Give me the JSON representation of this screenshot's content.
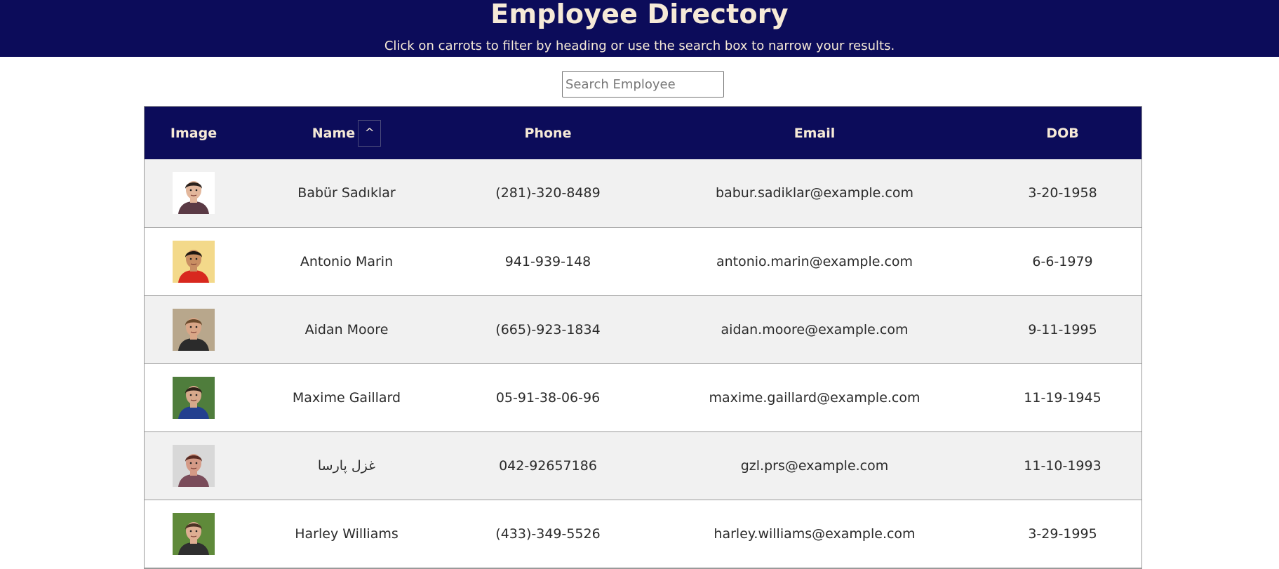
{
  "header": {
    "title": "Employee Directory",
    "subtitle": "Click on carrots to filter by heading or use the search box to narrow your results."
  },
  "search": {
    "placeholder": "Search Employee",
    "value": ""
  },
  "table": {
    "columns": {
      "image": "Image",
      "name": "Name",
      "sort_label": "^",
      "phone": "Phone",
      "email": "Email",
      "dob": "DOB"
    },
    "rows": [
      {
        "name": "Babür Sadıklar",
        "phone": "(281)-320-8489",
        "email": "babur.sadiklar@example.com",
        "dob": "3-20-1958"
      },
      {
        "name": "Antonio Marin",
        "phone": "941-939-148",
        "email": "antonio.marin@example.com",
        "dob": "6-6-1979"
      },
      {
        "name": "Aidan Moore",
        "phone": "(665)-923-1834",
        "email": "aidan.moore@example.com",
        "dob": "9-11-1995"
      },
      {
        "name": "Maxime Gaillard",
        "phone": "05-91-38-06-96",
        "email": "maxime.gaillard@example.com",
        "dob": "11-19-1945"
      },
      {
        "name": "غزل پارسا",
        "phone": "042-92657186",
        "email": "gzl.prs@example.com",
        "dob": "11-10-1993"
      },
      {
        "name": "Harley Williams",
        "phone": "(433)-349-5526",
        "email": "harley.williams@example.com",
        "dob": "3-29-1995"
      }
    ]
  },
  "avatars": [
    {
      "icon": "person-photo-icon",
      "bg": "#ffffff",
      "skin": "#e3b79c",
      "hair": "#2a211c",
      "shirt": "#5a3a45"
    },
    {
      "icon": "person-photo-icon",
      "bg": "#f3d98a",
      "skin": "#c98e62",
      "hair": "#1e1712",
      "shirt": "#d8281e"
    },
    {
      "icon": "person-photo-icon",
      "bg": "#b8a78c",
      "skin": "#d9a687",
      "hair": "#6b4a2c",
      "shirt": "#2b2b2b"
    },
    {
      "icon": "person-photo-icon",
      "bg": "#4f7d3c",
      "skin": "#d7a98b",
      "hair": "#2d2118",
      "shirt": "#23408f"
    },
    {
      "icon": "person-photo-icon",
      "bg": "#d8d8d8",
      "skin": "#d49a86",
      "hair": "#5a2c24",
      "shirt": "#7a4c5a"
    },
    {
      "icon": "person-photo-icon",
      "bg": "#5f8a3a",
      "skin": "#deae92",
      "hair": "#4b3324",
      "shirt": "#2f2f2f"
    }
  ]
}
